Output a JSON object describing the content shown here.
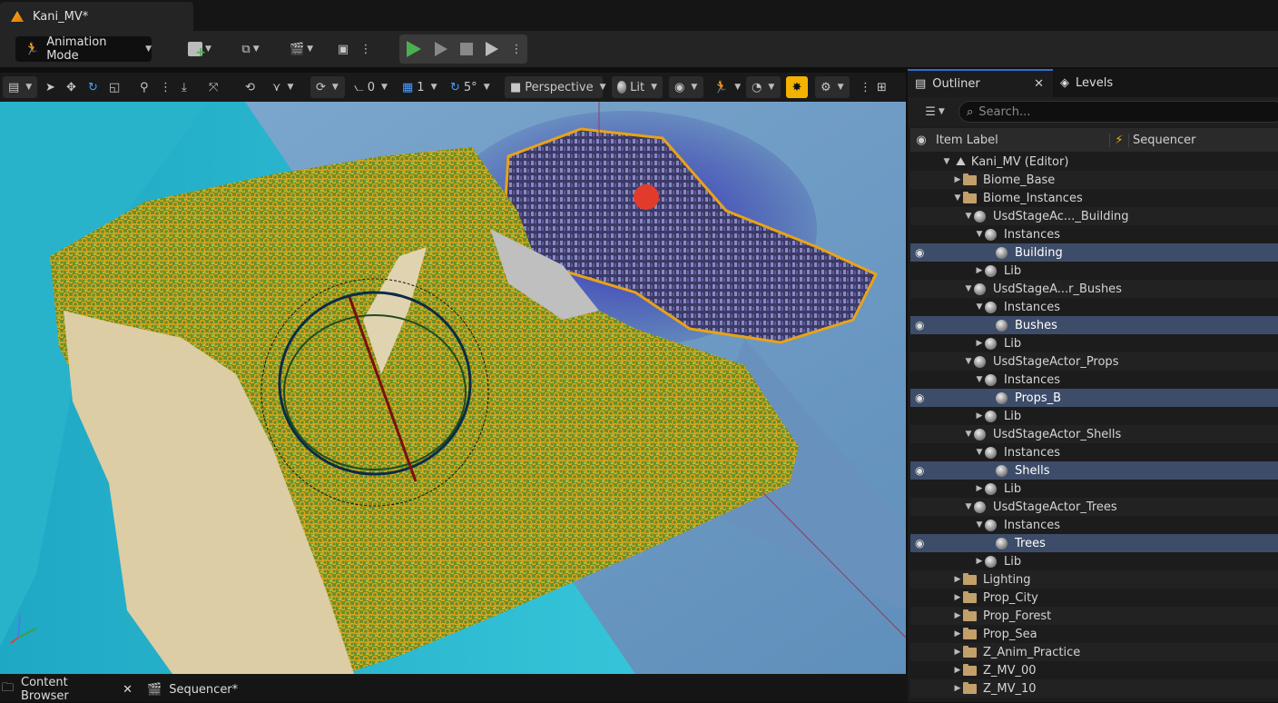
{
  "window": {
    "doc_tab": "Kani_MV*"
  },
  "toolbar": {
    "mode": "Animation Mode"
  },
  "viewport_toolbar": {
    "angle_snap_value": "0",
    "grid_value": "1",
    "rotate_snap_value": "5°",
    "view_mode": "Perspective",
    "lighting_mode": "Lit"
  },
  "outliner": {
    "tab_label": "Outliner",
    "levels_tab_label": "Levels",
    "search_placeholder": "Search...",
    "col_item_label": "Item Label",
    "col_sequencer": "Sequencer",
    "rows": [
      {
        "label": "Kani_MV (Editor)"
      },
      {
        "label": "Biome_Base"
      },
      {
        "label": "Biome_Instances"
      },
      {
        "label": "UsdStageAc..._Building"
      },
      {
        "label": "Instances"
      },
      {
        "label": "Building"
      },
      {
        "label": "Lib"
      },
      {
        "label": "UsdStageA...r_Bushes"
      },
      {
        "label": "Instances"
      },
      {
        "label": "Bushes"
      },
      {
        "label": "Lib"
      },
      {
        "label": "UsdStageActor_Props"
      },
      {
        "label": "Instances"
      },
      {
        "label": "Props_B"
      },
      {
        "label": "Lib"
      },
      {
        "label": "UsdStageActor_Shells"
      },
      {
        "label": "Instances"
      },
      {
        "label": "Shells"
      },
      {
        "label": "Lib"
      },
      {
        "label": "UsdStageActor_Trees"
      },
      {
        "label": "Instances"
      },
      {
        "label": "Trees"
      },
      {
        "label": "Lib"
      },
      {
        "label": "Lighting"
      },
      {
        "label": "Prop_City"
      },
      {
        "label": "Prop_Forest"
      },
      {
        "label": "Prop_Sea"
      },
      {
        "label": "Z_Anim_Practice"
      },
      {
        "label": "Z_MV_00"
      },
      {
        "label": "Z_MV_10"
      }
    ]
  },
  "bottom": {
    "content_browser": "Content Browser",
    "sequencer": "Sequencer*"
  },
  "colors": {
    "accent": "#f3b200",
    "selection": "#3d4c68",
    "play_green": "#4caf50"
  }
}
